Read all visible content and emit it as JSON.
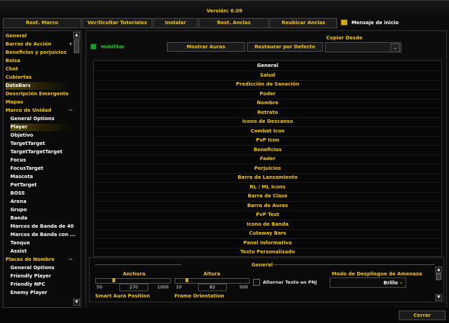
{
  "title": "Versión: 6.09",
  "tabs": [
    {
      "label": "Rest. Marco"
    },
    {
      "label": "Ver/Ocultar Tutoriales"
    },
    {
      "label": "Instalar"
    },
    {
      "label": "Rest. Anclas"
    },
    {
      "label": "Reubicar Anclas"
    }
  ],
  "startup_label": "Mensaje de inicio",
  "sidebar": {
    "items": [
      {
        "label": "General"
      },
      {
        "label": "Barras de Acción",
        "toggle": "+"
      },
      {
        "label": "Beneficios y perjuicios"
      },
      {
        "label": "Bolsa"
      },
      {
        "label": "Chat"
      },
      {
        "label": "Cubiertas"
      },
      {
        "label": "DataBars"
      },
      {
        "label": "Descripción Emergente"
      },
      {
        "label": "Mapas"
      },
      {
        "label": "Marco de Unidad",
        "toggle": "−"
      },
      {
        "label": "General Options"
      },
      {
        "label": "Player"
      },
      {
        "label": "Objetivo"
      },
      {
        "label": "TargetTarget"
      },
      {
        "label": "TargetTargetTarget"
      },
      {
        "label": "Focus"
      },
      {
        "label": "FocusTarget"
      },
      {
        "label": "Mascota"
      },
      {
        "label": "PetTarget"
      },
      {
        "label": "BOSS"
      },
      {
        "label": "Arena"
      },
      {
        "label": "Grupo"
      },
      {
        "label": "Banda"
      },
      {
        "label": "Marcos de Banda de 40"
      },
      {
        "label": "Marcos de Banda con ..."
      },
      {
        "label": "Tanque"
      },
      {
        "label": "Assist"
      },
      {
        "label": "Placas de Nombre",
        "toggle": "−"
      },
      {
        "label": "General Options"
      },
      {
        "label": "Friendly Player"
      },
      {
        "label": "Friendly NPC"
      },
      {
        "label": "Enemy Player"
      }
    ]
  },
  "enable_label": "Habilitar",
  "show_auras": "Mostrar Auras",
  "restore_default": "Restaurar por Defecto",
  "copy_from": "Copiar Desde",
  "list_rows": [
    "General",
    "Salud",
    "Predicción de Sanación",
    "Poder",
    "Nombre",
    "Retrato",
    "Icono de Descanso",
    "Combat Icon",
    "PvP Icon",
    "Beneficios",
    "Fader",
    "Perjuicios",
    "Barra de Lanzamiento",
    "RL / ML Icons",
    "Barra de Clase",
    "Barra de Auras",
    "PvP Text",
    "Icono de Banda",
    "Cutaway Bars",
    "Panel Informativo",
    "Texto Personalizado"
  ],
  "panel": {
    "title": "General",
    "width": {
      "label": "Anchura",
      "min": "50",
      "value": "270",
      "max": "1000",
      "fraction": 0.23
    },
    "height": {
      "label": "Altura",
      "min": "10",
      "value": "82",
      "max": "500",
      "fraction": 0.15
    },
    "alt_text": "Alternar Texto en PNJ",
    "threat_label": "Modo de Despliegue de Amenaza",
    "threat_value": "Brillo",
    "smart_aura": "Smart Aura Position",
    "frame_orientation": "Frame Orientation"
  },
  "close": "Cerrar"
}
